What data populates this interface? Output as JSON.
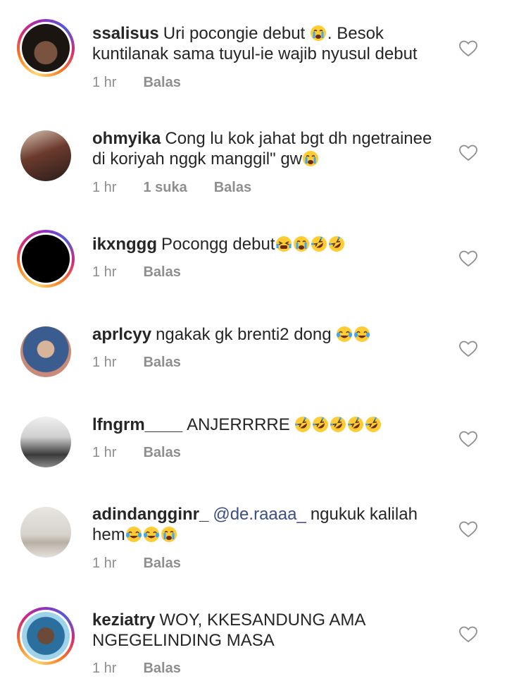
{
  "comments": [
    {
      "username": "ssalisus",
      "text": "Uri pocongie debut",
      "text_line2": "kuntilanak sama tuyul-ie wajib nyusul debut",
      "text_mid": ". Besok",
      "time": "1 hr",
      "likes": "",
      "reply": "Balas",
      "emoji_after": [
        "crying-emoji"
      ]
    },
    {
      "username": "ohmyika",
      "text": "Cong lu kok jahat bgt dh ngetrainee",
      "text_line2": "di koriyah nggk manggil\" gw",
      "time": "1 hr",
      "likes": "1 suka",
      "reply": "Balas",
      "emoji_after": [
        "crying-emoji"
      ]
    },
    {
      "username": "ikxnggg",
      "text": "Pocongg debut",
      "time": "1 hr",
      "likes": "",
      "reply": "Balas",
      "emoji_after": [
        "tired-crying-emoji",
        "crying-emoji",
        "rofl-emoji",
        "rofl-emoji"
      ]
    },
    {
      "username": "aprlcyy",
      "text": "ngakak gk brenti2 dong",
      "time": "1 hr",
      "likes": "",
      "reply": "Balas",
      "emoji_after": [
        "tears-of-joy-emoji",
        "tears-of-joy-emoji"
      ]
    },
    {
      "username": "lfngrm____",
      "text": "ANJERRRRE",
      "time": "1 hr",
      "likes": "",
      "reply": "Balas",
      "emoji_after": [
        "rofl-emoji",
        "rofl-emoji",
        "rofl-emoji",
        "rofl-emoji",
        "rofl-emoji"
      ]
    },
    {
      "username": "adindangginr_",
      "mention": "@de.raaaa_",
      "text": "ngukuk kalilah",
      "text_line2": "hem",
      "time": "1 hr",
      "likes": "",
      "reply": "Balas",
      "emoji_after": [
        "tears-of-joy-emoji",
        "tears-of-joy-emoji",
        "crying-emoji"
      ]
    },
    {
      "username": "keziatry",
      "text": "WOY, KKESANDUNG AMA",
      "text_line2": "NGEGELINDING MASA",
      "time": "1 hr",
      "likes": "",
      "reply": "Balas",
      "emoji_after": []
    }
  ],
  "colors": {
    "text": "#262626",
    "meta": "#8e8e8e",
    "mention": "#3b4e86",
    "story_ring": [
      "#feda75",
      "#fa7e1e",
      "#d62976",
      "#962fbf",
      "#4f5bd5"
    ]
  },
  "icons": {
    "like": "heart-outline-icon"
  }
}
